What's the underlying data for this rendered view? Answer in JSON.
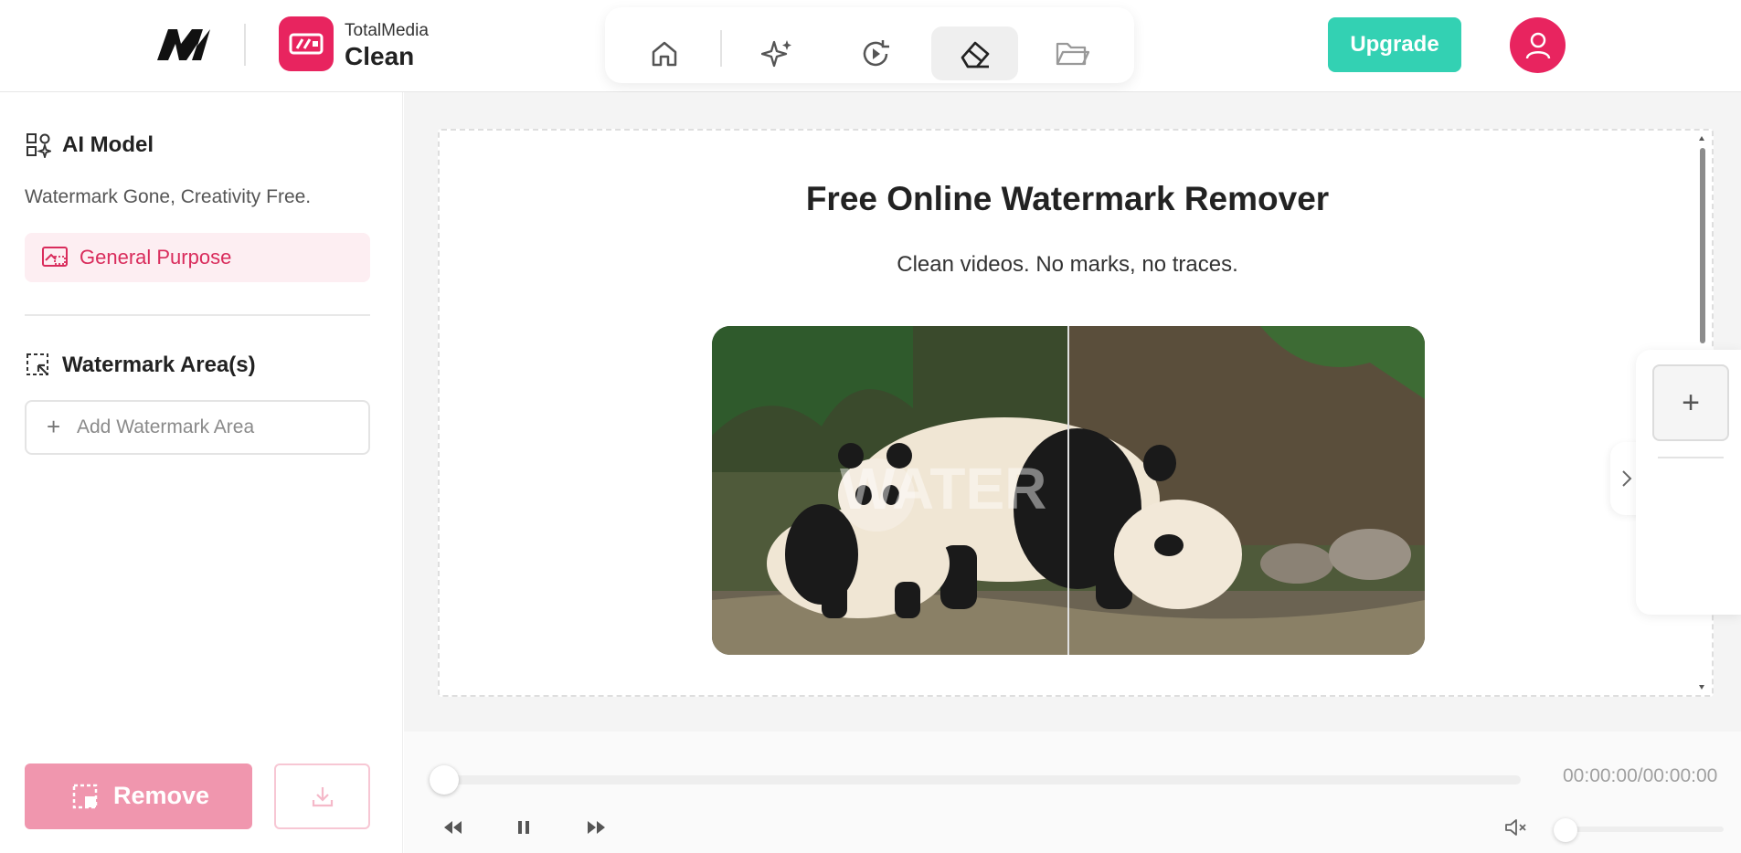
{
  "header": {
    "brand_logo": "M-logo",
    "app_name_top": "TotalMedia",
    "app_name_bottom": "Clean",
    "toolbar": [
      {
        "name": "home",
        "icon": "home-icon"
      },
      {
        "name": "ai-enhance",
        "icon": "sparkle-icon"
      },
      {
        "name": "convert",
        "icon": "refresh-play-icon"
      },
      {
        "name": "watermark-remover",
        "icon": "eraser-icon",
        "active": true
      },
      {
        "name": "files",
        "icon": "folder-icon"
      }
    ],
    "upgrade_label": "Upgrade",
    "accent_color": "#33d1b3",
    "brand_color": "#e8245f"
  },
  "sidebar": {
    "ai_model_title": "AI Model",
    "tagline": "Watermark Gone, Creativity Free.",
    "model_option": "General Purpose",
    "watermark_title": "Watermark Area(s)",
    "add_area_label": "Add Watermark Area",
    "remove_label": "Remove"
  },
  "main": {
    "title": "Free Online Watermark Remover",
    "subtitle": "Clean videos. No marks, no traces.",
    "preview_watermark": "WATER"
  },
  "player": {
    "time": "00:00:00/00:00:00",
    "progress": 0,
    "volume": 0
  }
}
